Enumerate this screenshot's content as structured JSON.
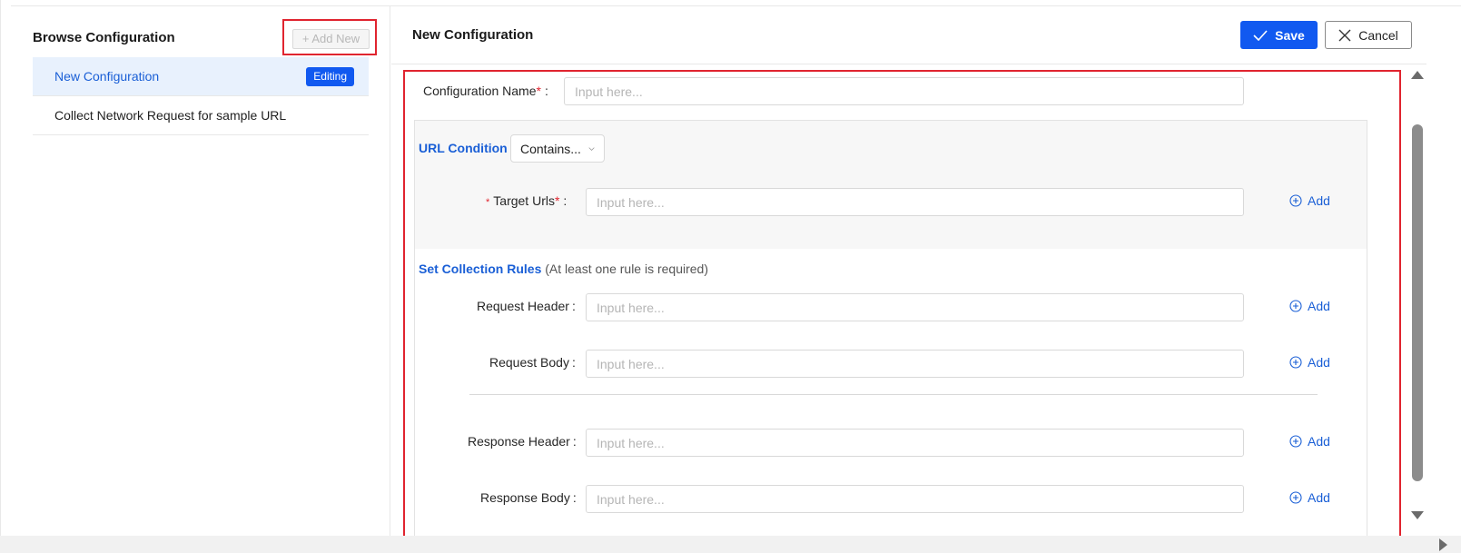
{
  "sidebar": {
    "title": "Browse Configuration",
    "add_new_label": "+ Add New",
    "items": [
      {
        "label": "New Configuration",
        "badge": "Editing"
      },
      {
        "label": "Collect Network Request for sample URL"
      }
    ]
  },
  "header": {
    "title": "New Configuration",
    "save_label": "Save",
    "cancel_label": "Cancel"
  },
  "form": {
    "config_name": {
      "label": "Configuration Name",
      "required_mark": "*",
      "colon": ":",
      "placeholder": "Input here..."
    },
    "url_condition": {
      "title": "URL Condition",
      "select_value": "Contains...",
      "target_urls": {
        "prefix_mark": "*",
        "label": "Target Urls",
        "required_mark": "*",
        "colon": ":",
        "placeholder": "Input here...",
        "add_label": "Add"
      }
    },
    "collection_rules": {
      "title": "Set Collection Rules",
      "note": "(At least one rule is required)",
      "rows": [
        {
          "label": "Request Header",
          "colon": ":",
          "placeholder": "Input here...",
          "add_label": "Add"
        },
        {
          "label": "Request Body",
          "colon": ":",
          "placeholder": "Input here...",
          "add_label": "Add"
        },
        {
          "label": "Response Header",
          "colon": ":",
          "placeholder": "Input here...",
          "add_label": "Add"
        },
        {
          "label": "Response Body",
          "colon": ":",
          "placeholder": "Input here...",
          "add_label": "Add"
        }
      ]
    }
  },
  "colors": {
    "primary": "#1159f0",
    "link": "#1a5fd6",
    "required": "#e0242f",
    "highlight_border": "#e0242f",
    "active_row_bg": "#e8f1fd"
  },
  "icons": {
    "save": "check-icon",
    "cancel": "close-icon",
    "add": "plus-circle-icon",
    "select": "chevron-down-icon"
  }
}
